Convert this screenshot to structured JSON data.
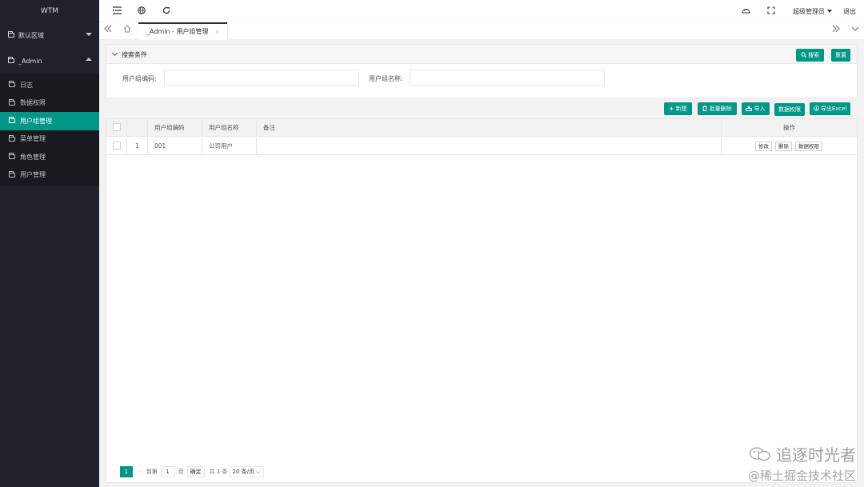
{
  "sidebar": {
    "logo": "WTM",
    "groups": [
      {
        "label": "默认区域",
        "expanded": false
      },
      {
        "label": "_Admin",
        "expanded": true
      }
    ],
    "items": [
      "日志",
      "数据权限",
      "用户组管理",
      "菜单管理",
      "角色管理",
      "用户管理"
    ],
    "active_item": "用户组管理"
  },
  "header": {
    "admin": "超级管理员",
    "logout": "退出"
  },
  "tabs": {
    "active": "_Admin - 用户组管理",
    "close": "×"
  },
  "search": {
    "title": "搜索条件",
    "search_btn": "搜索",
    "reset_btn": "重置",
    "fields": [
      {
        "label": "用户组编码:",
        "value": ""
      },
      {
        "label": "用户组名称:",
        "value": ""
      }
    ]
  },
  "toolbar": {
    "new": "新建",
    "batch_delete": "批量删除",
    "import": "导入",
    "data_permission": "数据权限",
    "export": "导出Excel"
  },
  "table": {
    "columns": [
      "用户组编码",
      "用户组名称",
      "备注",
      "操作"
    ],
    "rows": [
      {
        "index": "1",
        "code": "001",
        "name": "公司用户",
        "remark": "",
        "actions": [
          "修改",
          "删除",
          "数据权限"
        ]
      }
    ]
  },
  "pager": {
    "current": "1",
    "goto_label": "到第",
    "goto_value": "1",
    "page_unit": "页",
    "confirm": "确定",
    "total": "共 1 条",
    "page_size": "20 条/页"
  },
  "watermark": {
    "line1": "追逐时光者",
    "line2": "@稀土掘金技术社区"
  },
  "colors": {
    "primary": "#009688",
    "sidebar_bg": "#20222a"
  }
}
